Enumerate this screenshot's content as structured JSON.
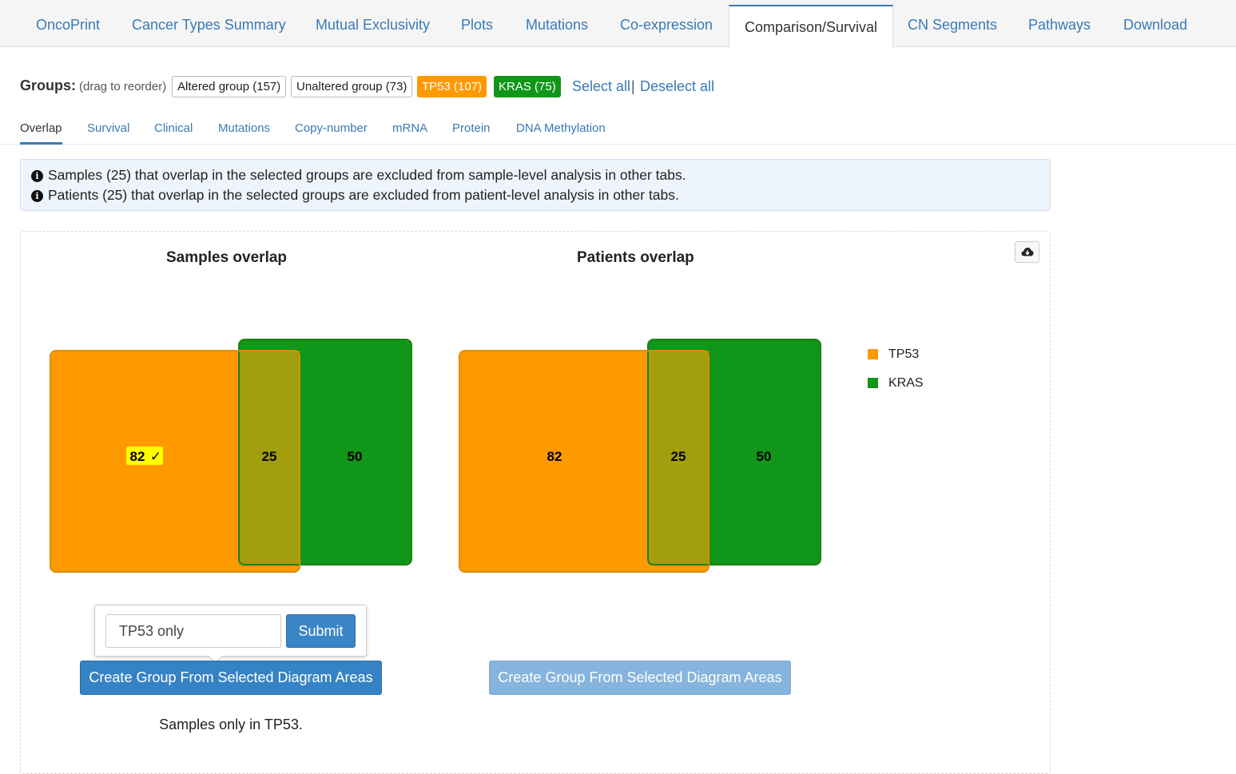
{
  "top_tabs": [
    {
      "label": "OncoPrint"
    },
    {
      "label": "Cancer Types Summary"
    },
    {
      "label": "Mutual Exclusivity"
    },
    {
      "label": "Plots"
    },
    {
      "label": "Mutations"
    },
    {
      "label": "Co-expression"
    },
    {
      "label": "Comparison/Survival",
      "active": true
    },
    {
      "label": "CN Segments"
    },
    {
      "label": "Pathways"
    },
    {
      "label": "Download"
    }
  ],
  "groups": {
    "label": "Groups:",
    "hint": "(drag to reorder)",
    "chips": [
      {
        "label": "Altered group (157)"
      },
      {
        "label": "Unaltered group (73)"
      },
      {
        "label": "TP53 (107)",
        "color": "#ff9900"
      },
      {
        "label": "KRAS (75)",
        "color": "#109618"
      }
    ],
    "select_all": "Select all",
    "separator": "|",
    "deselect_all": "Deselect all"
  },
  "sub_tabs": [
    {
      "label": "Overlap",
      "active": true
    },
    {
      "label": "Survival"
    },
    {
      "label": "Clinical"
    },
    {
      "label": "Mutations"
    },
    {
      "label": "Copy-number"
    },
    {
      "label": "mRNA"
    },
    {
      "label": "Protein"
    },
    {
      "label": "DNA Methylation"
    }
  ],
  "alert": {
    "icon": "info-circle-icon",
    "lines": [
      "Samples (25) that overlap in the selected groups are excluded from sample-level analysis in other tabs.",
      "Patients (25) that overlap in the selected groups are excluded from patient-level analysis in other tabs."
    ]
  },
  "download_icon": "cloud-download-icon",
  "samples_venn": {
    "title": "Samples overlap",
    "regions": {
      "tp53_only": "82",
      "overlap": "25",
      "kras_only": "50"
    },
    "selected_mark": "✓",
    "selected_region": "tp53_only"
  },
  "patients_venn": {
    "title": "Patients overlap",
    "regions": {
      "tp53_only": "82",
      "overlap": "25",
      "kras_only": "50"
    }
  },
  "legend": [
    {
      "label": "TP53",
      "color": "#ff9900"
    },
    {
      "label": "KRAS",
      "color": "#109618"
    }
  ],
  "popover": {
    "name_value": "TP53 only",
    "submit_label": "Submit"
  },
  "create_group_label": "Create Group From Selected Diagram Areas",
  "selection_caption": "Samples only in TP53."
}
